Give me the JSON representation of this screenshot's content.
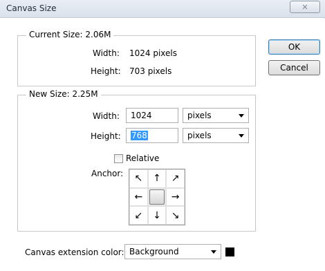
{
  "window": {
    "title": "Canvas Size",
    "close_glyph": "✕"
  },
  "current_size": {
    "legend": "Current Size: 2.06M",
    "width_label": "Width:",
    "width_value": "1024 pixels",
    "height_label": "Height:",
    "height_value": "703 pixels"
  },
  "new_size": {
    "legend": "New Size: 2.25M",
    "width_label": "Width:",
    "width_value": "1024",
    "width_unit": "pixels",
    "height_label": "Height:",
    "height_value": "768",
    "height_unit": "pixels",
    "relative_label": "Relative",
    "relative_checked": false,
    "anchor_label": "Anchor:",
    "anchor_arrows": [
      "↖",
      "↑",
      "↗",
      "←",
      "",
      "→",
      "↙",
      "↓",
      "↘"
    ]
  },
  "buttons": {
    "ok": "OK",
    "cancel": "Cancel"
  },
  "extension": {
    "label": "Canvas extension color:",
    "value": "Background",
    "swatch_color": "#000000"
  }
}
